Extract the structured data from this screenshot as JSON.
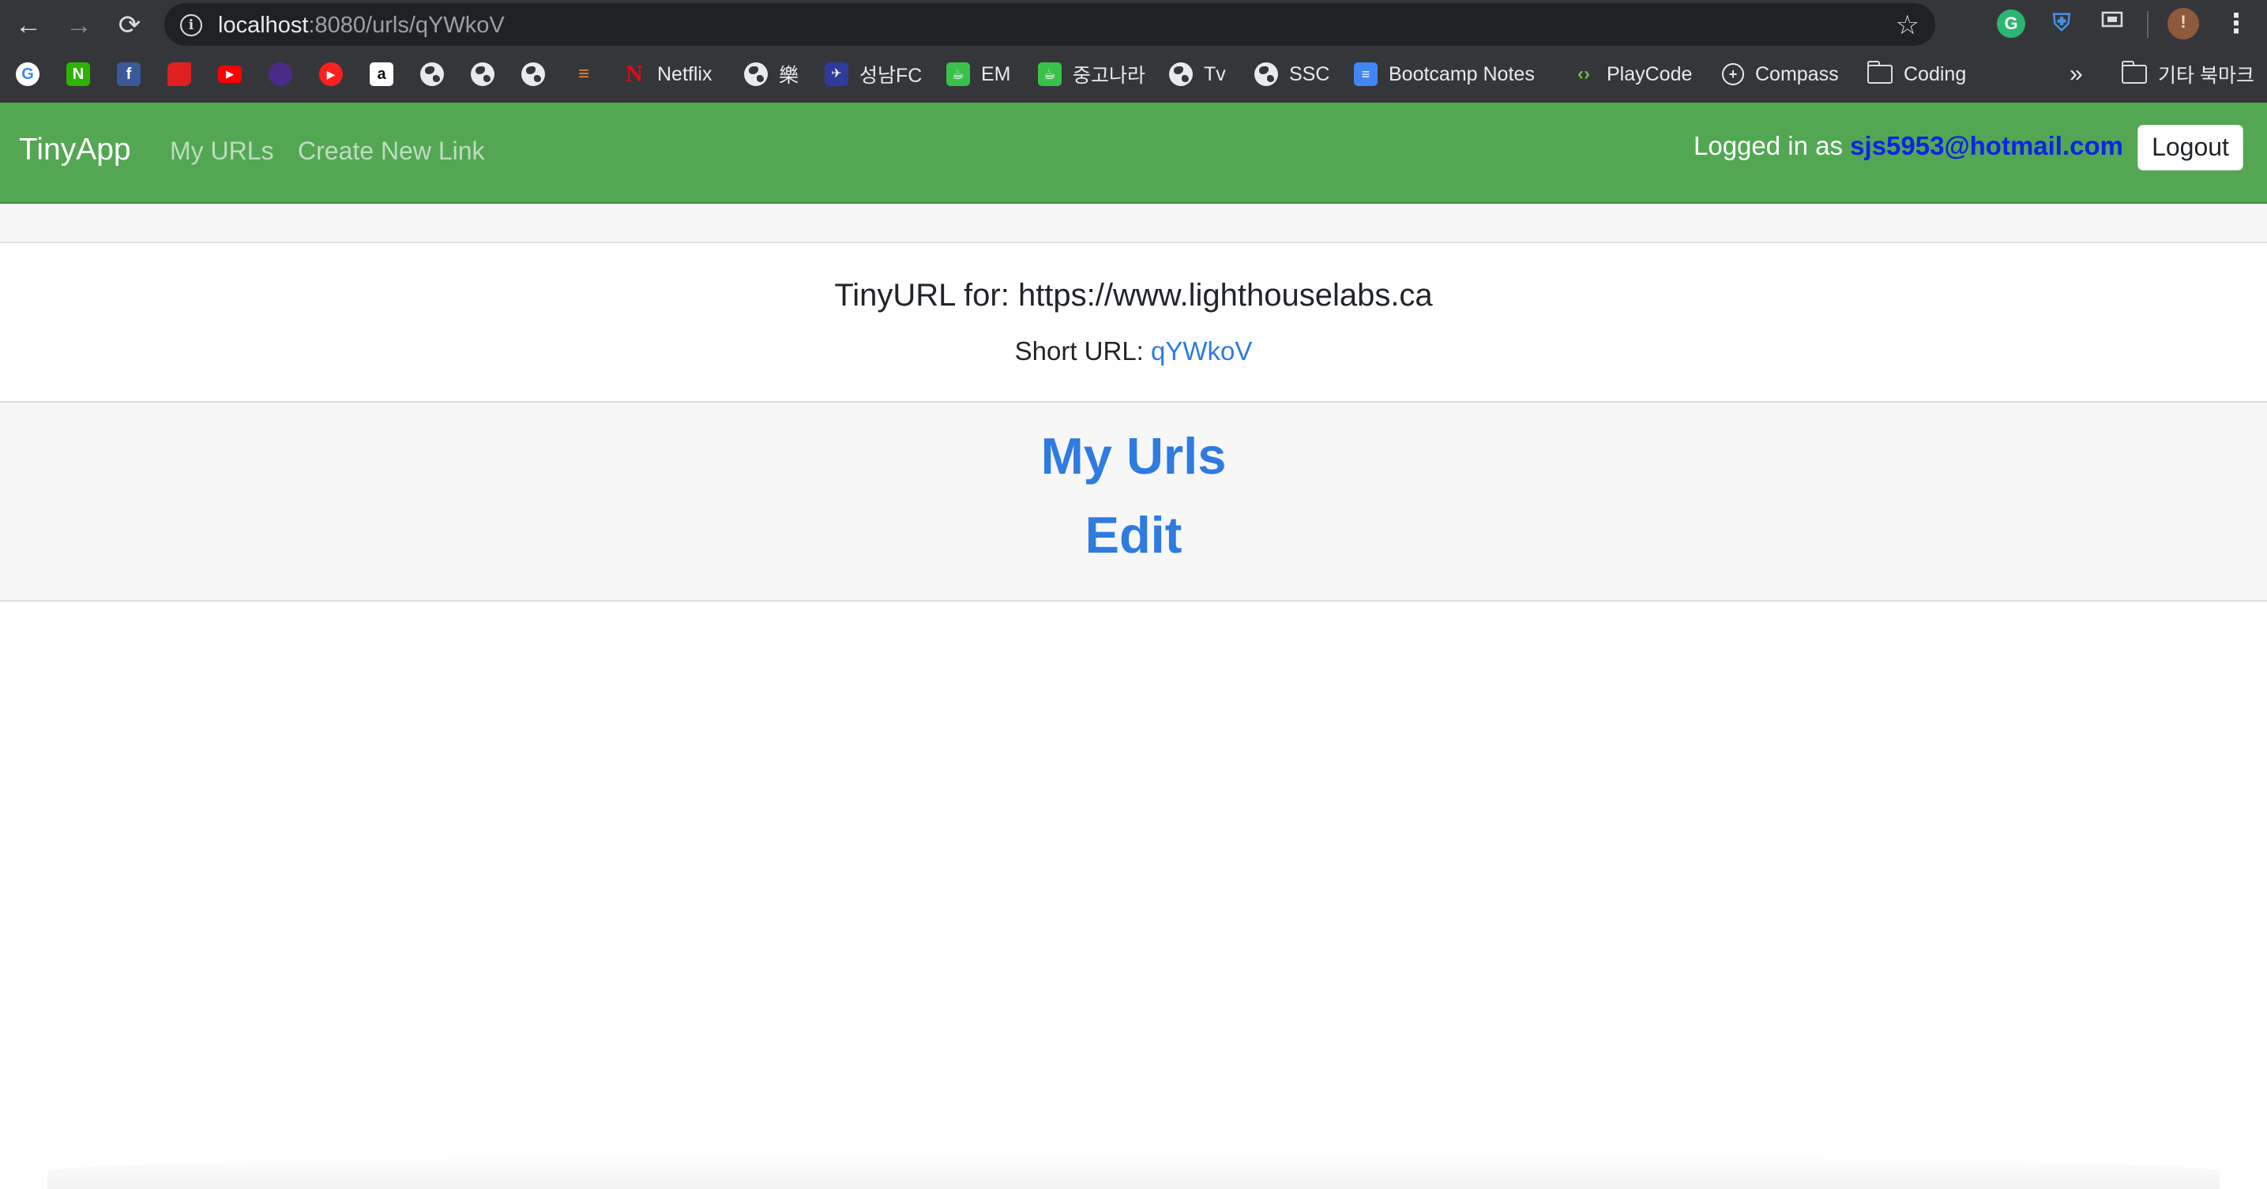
{
  "browser": {
    "url_host": "localhost",
    "url_path": ":8080/urls/qYWkoV",
    "bookmarks": [
      {
        "icon": "google-icon",
        "label": ""
      },
      {
        "icon": "naver-icon",
        "label": ""
      },
      {
        "icon": "facebook-icon",
        "label": ""
      },
      {
        "icon": "red-logo-icon",
        "label": ""
      },
      {
        "icon": "youtube-icon",
        "label": ""
      },
      {
        "icon": "purple-logo-icon",
        "label": ""
      },
      {
        "icon": "youtube-music-icon",
        "label": ""
      },
      {
        "icon": "amazon-icon",
        "label": ""
      },
      {
        "icon": "globe-icon",
        "label": ""
      },
      {
        "icon": "globe-icon",
        "label": ""
      },
      {
        "icon": "globe-icon",
        "label": ""
      },
      {
        "icon": "stackoverflow-icon",
        "label": ""
      },
      {
        "icon": "netflix-icon",
        "label": "Netflix"
      },
      {
        "icon": "globe-icon",
        "label": "樂"
      },
      {
        "icon": "seongnam-fc-icon",
        "label": "성남FC"
      },
      {
        "icon": "cafe-icon",
        "label": "EM"
      },
      {
        "icon": "cafe-icon",
        "label": "중고나라"
      },
      {
        "icon": "globe-icon",
        "label": "Tv"
      },
      {
        "icon": "globe-icon",
        "label": "SSC"
      },
      {
        "icon": "docs-icon",
        "label": "Bootcamp Notes"
      },
      {
        "icon": "playcode-icon",
        "label": "PlayCode"
      },
      {
        "icon": "compass-icon",
        "label": "Compass"
      },
      {
        "icon": "folder-icon",
        "label": "Coding"
      }
    ],
    "overflow_label": "»",
    "other_bookmarks_label": "기타 북마크"
  },
  "app": {
    "brand": "TinyApp",
    "nav_links": [
      "My URLs",
      "Create New Link"
    ],
    "logged_in_prefix": "Logged in as",
    "user_email": "sjs5953@hotmail.com",
    "logout_label": "Logout"
  },
  "card": {
    "title": "TinyURL for: https://www.lighthouselabs.ca",
    "short_url_label": "Short URL:",
    "short_url_value": "qYWkoV",
    "footer_links": [
      "My Urls",
      "Edit"
    ]
  },
  "colors": {
    "chrome_bg": "#35363a",
    "navbar_green": "#53a753",
    "link_blue": "#2f7be0",
    "email_blue": "#0b24e6"
  }
}
